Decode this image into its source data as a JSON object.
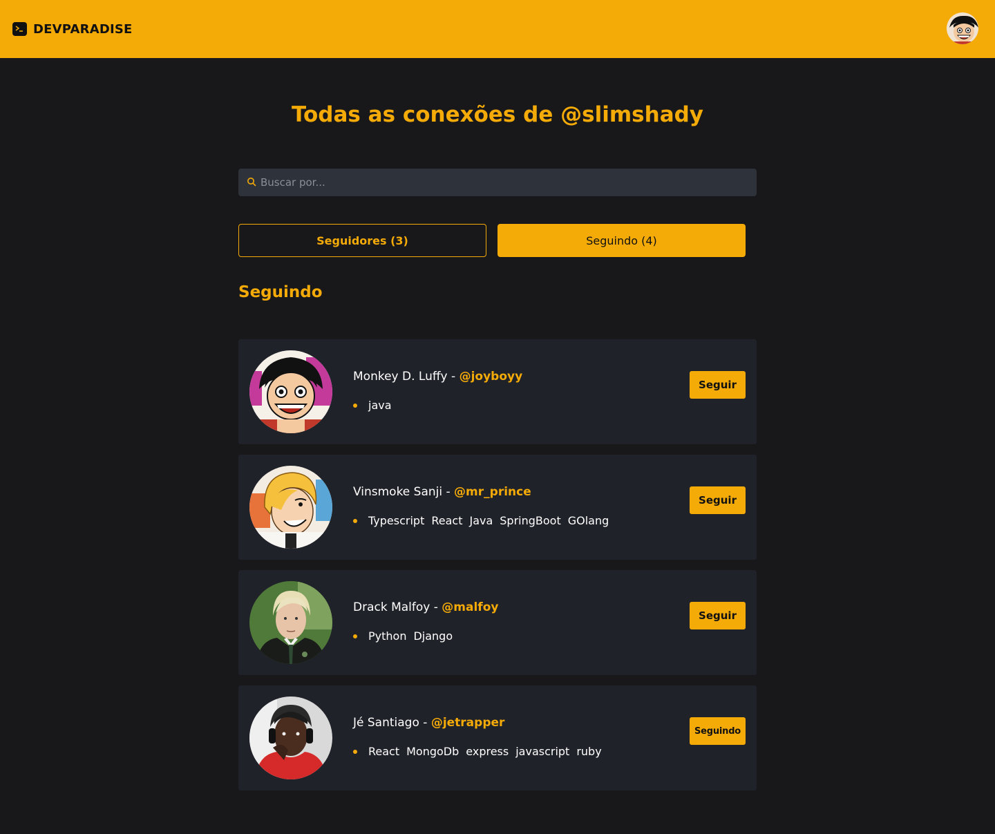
{
  "header": {
    "brand": "DEVPARADISE",
    "brand_color": "#f5ab07"
  },
  "page": {
    "title": "Todas as conexões de @slimshady"
  },
  "search": {
    "placeholder": "Buscar por..."
  },
  "tabs": [
    {
      "label": "Seguidores (3)",
      "active": false
    },
    {
      "label": "Seguindo (4)",
      "active": true
    }
  ],
  "section": {
    "title": "Seguindo"
  },
  "users": [
    {
      "name": "Monkey D. Luffy - ",
      "handle": "@joyboyy",
      "techs": [
        "java"
      ],
      "button": "Seguir",
      "avatar": "luffy-portrait"
    },
    {
      "name": "Vinsmoke Sanji - ",
      "handle": "@mr_prince",
      "techs": [
        "Typescript",
        "React",
        "Java",
        "SpringBoot",
        "GOlang"
      ],
      "button": "Seguir",
      "avatar": "sanji-portrait"
    },
    {
      "name": "Drack Malfoy - ",
      "handle": "@malfoy",
      "techs": [
        "Python",
        "Django"
      ],
      "button": "Seguir",
      "avatar": "malfoy-portrait"
    },
    {
      "name": "Jé Santiago - ",
      "handle": "@jetrapper",
      "techs": [
        "React",
        "MongoDb",
        "express",
        "javascript",
        "ruby"
      ],
      "button": "Seguindo",
      "avatar": "santiago-portrait"
    }
  ]
}
